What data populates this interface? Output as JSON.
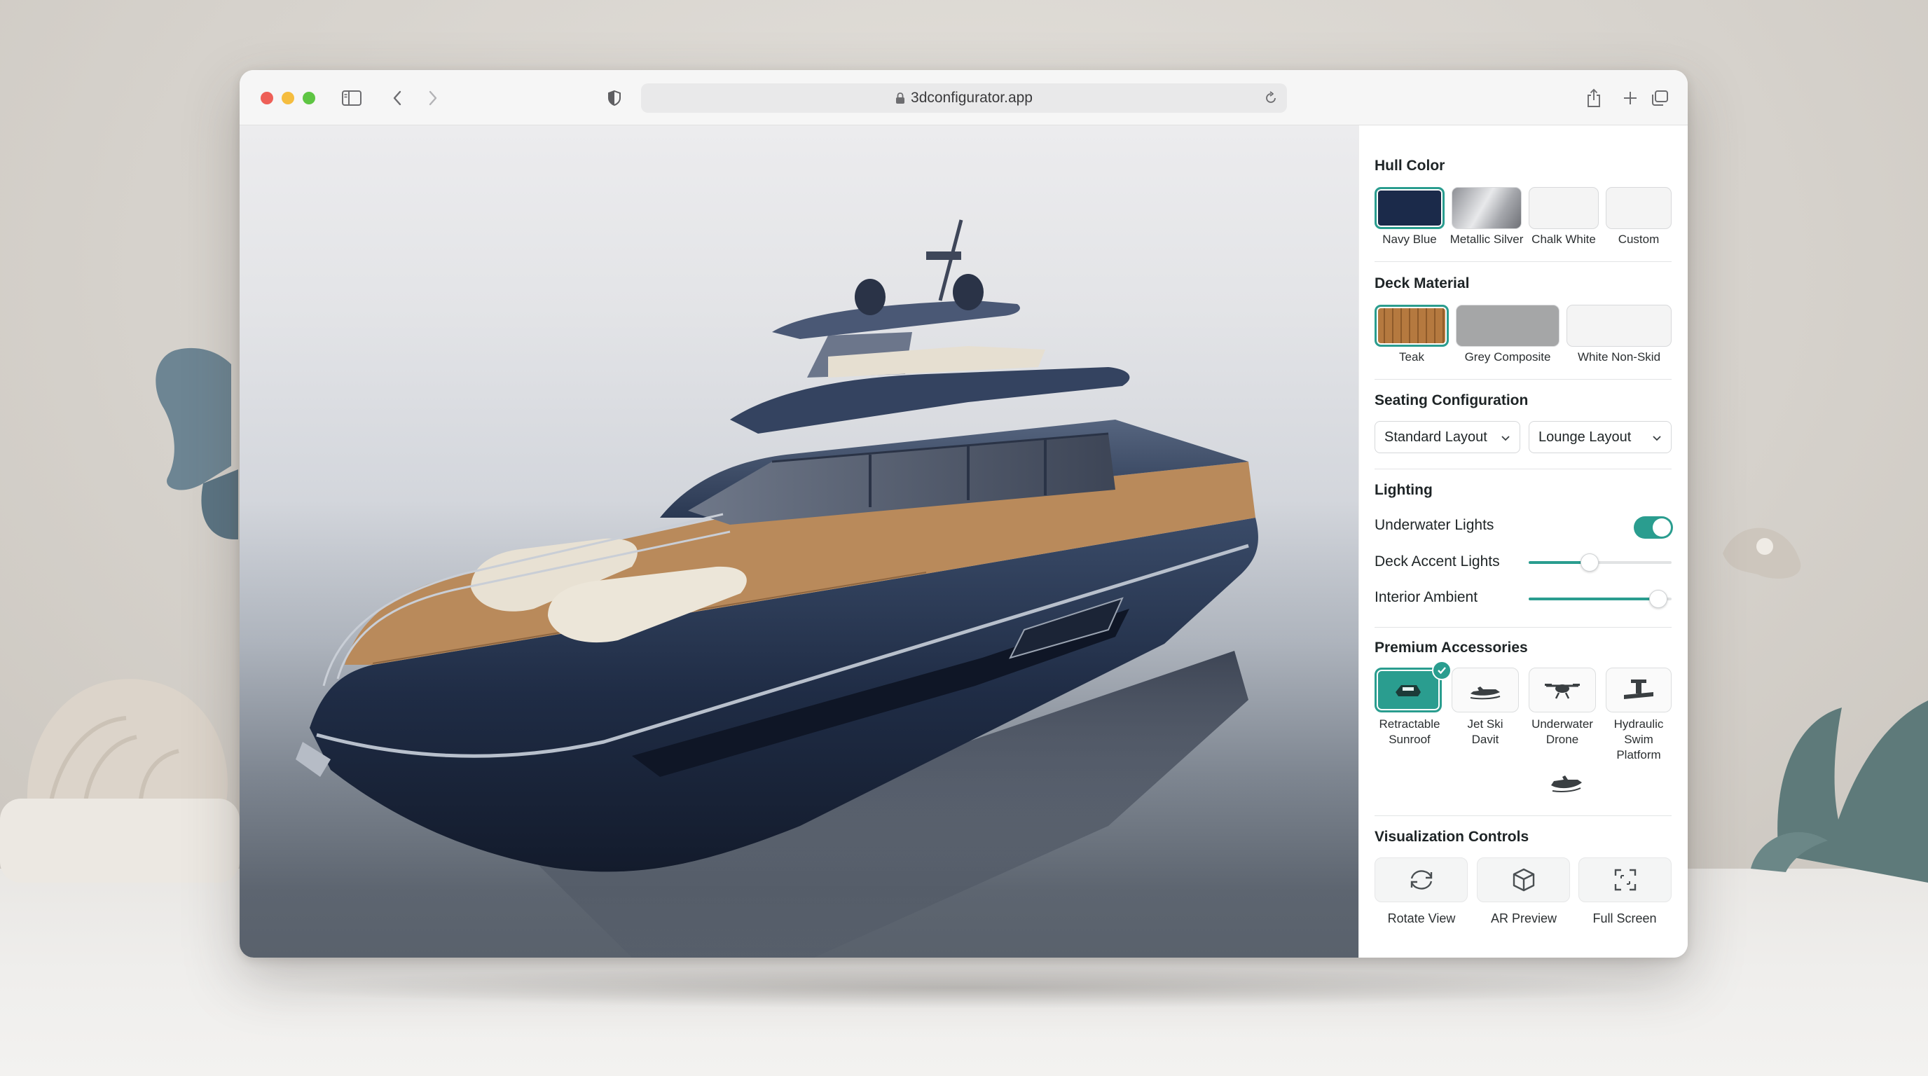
{
  "browser": {
    "url": "3dconfigurator.app"
  },
  "colors": {
    "accent": "#2a9d8f",
    "navy_blue": "#1b2a4a",
    "teak": "#b5793f",
    "grey_composite": "#a5a6a7",
    "chalk_white": "#f4f4f4"
  },
  "hull_color": {
    "title": "Hull Color",
    "options": [
      {
        "label": "Navy Blue",
        "selected": true
      },
      {
        "label": "Metallic Silver",
        "selected": false
      },
      {
        "label": "Chalk White",
        "selected": false
      },
      {
        "label": "Custom",
        "selected": false
      }
    ]
  },
  "deck_material": {
    "title": "Deck Material",
    "options": [
      {
        "label": "Teak",
        "selected": true
      },
      {
        "label": "Grey Composite",
        "selected": false
      },
      {
        "label": "White Non-Skid",
        "selected": false
      }
    ]
  },
  "seating": {
    "title": "Seating Configuration",
    "dropdowns": [
      {
        "value": "Standard Layout"
      },
      {
        "value": "Lounge Layout"
      }
    ]
  },
  "lighting": {
    "title": "Lighting",
    "underwater": {
      "label": "Underwater Lights",
      "on": true
    },
    "deck_accent": {
      "label": "Deck Accent Lights",
      "level": 0.42
    },
    "interior_ambient": {
      "label": "Interior Ambient",
      "level": 0.9
    }
  },
  "accessories": {
    "title": "Premium Accessories",
    "items": [
      {
        "label_line1": "Retractable",
        "label_line2": "Sunroof",
        "icon": "sunroof-icon",
        "selected": true
      },
      {
        "label_line1": "Jet Ski",
        "label_line2": "Davit",
        "icon": "jet-ski-icon",
        "selected": false
      },
      {
        "label_line1": "Underwater",
        "label_line2": "Drone",
        "icon": "drone-icon",
        "selected": false
      },
      {
        "label_line1": "Hydraulic",
        "label_line2": "Swim",
        "label_line3": "Platform",
        "icon": "swim-platform-icon",
        "selected": false
      }
    ],
    "extra_icon": "tender-boat-icon"
  },
  "visualization": {
    "title": "Visualization Controls",
    "buttons": [
      {
        "label": "Rotate View",
        "icon": "rotate-icon"
      },
      {
        "label": "AR Preview",
        "icon": "cube-icon"
      },
      {
        "label": "Full Screen",
        "icon": "fullscreen-icon"
      }
    ]
  }
}
